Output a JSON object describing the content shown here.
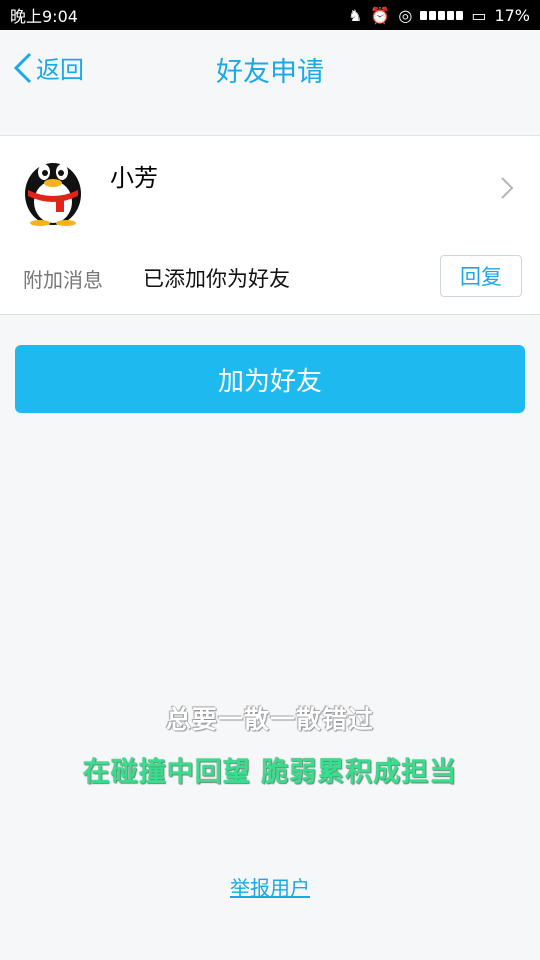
{
  "status_bar": {
    "time": "晚上9:04",
    "battery": "17%"
  },
  "nav": {
    "back_label": "返回",
    "title": "好友申请"
  },
  "profile": {
    "name": "小芳"
  },
  "message": {
    "label": "附加消息",
    "text": "已添加你为好友",
    "reply_label": "回复"
  },
  "add_friend_label": "加为好友",
  "signature": {
    "line1": "总要一散一散错过",
    "line2": "在碰撞中回望 脆弱累积成担当"
  },
  "report_label": "举报用户",
  "colors": {
    "accent": "#19a9e6",
    "button": "#1eb9ef",
    "signature_green": "#3cdc8e"
  }
}
